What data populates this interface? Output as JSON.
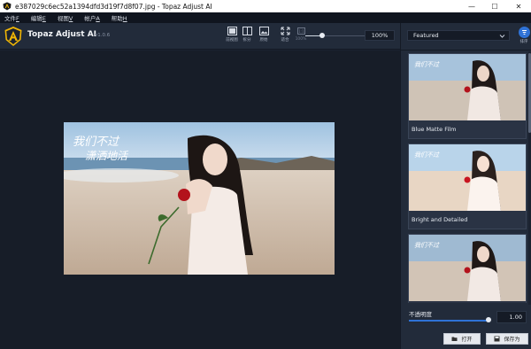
{
  "window": {
    "title": "e387029c6ec52a1394dfd3d19f7d8f07.jpg - Topaz Adjust AI",
    "minimize": "—",
    "maximize": "☐",
    "close": "✕"
  },
  "menu": [
    {
      "label": "文件",
      "key": "F"
    },
    {
      "label": "编辑",
      "key": "E"
    },
    {
      "label": "视图",
      "key": "V"
    },
    {
      "label": "帐户",
      "key": "A"
    },
    {
      "label": "帮助",
      "key": "H"
    }
  ],
  "toolbar": {
    "brand": "Topaz Adjust AI",
    "version": "v1.0.6",
    "views": [
      {
        "label": "前视图",
        "icon": "single-view-icon"
      },
      {
        "label": "拆分",
        "icon": "split-view-icon"
      },
      {
        "label": "原始",
        "icon": "original-image-icon"
      },
      {
        "label": "适合",
        "icon": "fit-screen-icon"
      },
      {
        "label": "100%",
        "icon": "actual-size-icon"
      }
    ],
    "zoom_value": "100%",
    "zoom_fraction": 0.27
  },
  "panel": {
    "category": "Featured",
    "sort_label": "排序",
    "presets": [
      {
        "name": "Blue Matte Film"
      },
      {
        "name": "Bright and Detailed"
      },
      {
        "name": ""
      }
    ],
    "opacity_label": "不透明度",
    "opacity_value": "1.00",
    "opacity_fraction": 1.0,
    "open_button": "打开",
    "saveas_button": "保存为"
  },
  "photo": {
    "caption_line1": "我们不过",
    "caption_line2": "潇洒地活"
  },
  "colors": {
    "accent": "#2f72d6",
    "brand_yellow": "#f2b705",
    "bg_dark": "#171d28",
    "panel": "#222b3a"
  }
}
